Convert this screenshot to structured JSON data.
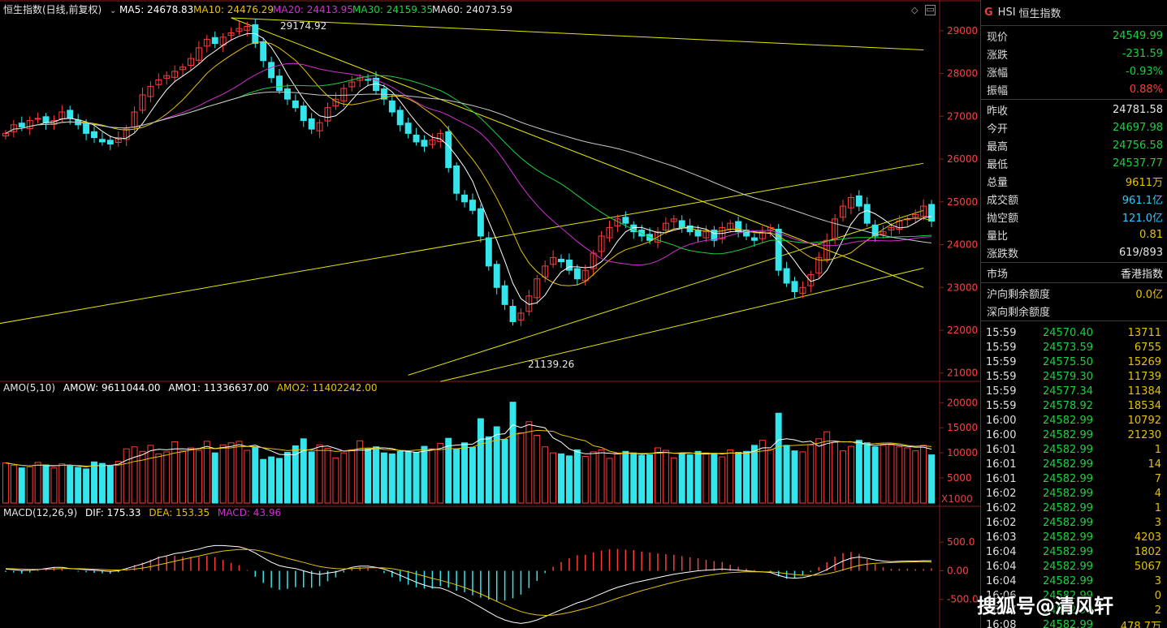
{
  "main_panel": {
    "title": "恒生指数(日线,前复权)",
    "ma5": "MA5: 24678.83",
    "ma10": "MA10: 24476.29",
    "ma20": "MA20: 24413.95",
    "ma30": "MA30: 24159.35",
    "ma60": "MA60: 24073.59",
    "high_label": "29174.92",
    "low_label": "21139.26",
    "y_ticks": [
      "29000",
      "28000",
      "27000",
      "26000",
      "25000",
      "24000",
      "23000",
      "22000",
      "21000"
    ],
    "colors": {
      "ma5": "#ffffff",
      "ma10": "#e6c200",
      "ma20": "#d030d0",
      "ma30": "#19d23f",
      "ma60": "#c8c8c8",
      "up": "#ff3b3b",
      "down": "#34e6ec",
      "trendline": "#e6e600"
    }
  },
  "amo_panel": {
    "label": "AMO(5,10)",
    "amow": "AMOW: 9611044.00",
    "amo1": "AMO1: 11336637.00",
    "amo2": "AMO2: 11402242.00",
    "y_ticks": [
      "20000",
      "15000",
      "10000",
      "5000"
    ],
    "unit": "X1000"
  },
  "macd_panel": {
    "label": "MACD(12,26,9)",
    "dif": "DIF: 175.33",
    "dea": "DEA: 153.35",
    "macd": "MACD: 43.96",
    "y_ticks": [
      "500.0",
      "0.00",
      "-500.0"
    ]
  },
  "sidebar": {
    "logo": "G",
    "code": "HSI",
    "name": "恒生指数",
    "quote": [
      {
        "k": "现价",
        "v": "24549.99",
        "c": "g1"
      },
      {
        "k": "涨跌",
        "v": "-231.59",
        "c": "g1"
      },
      {
        "k": "涨幅",
        "v": "-0.93%",
        "c": "g1"
      },
      {
        "k": "振幅",
        "v": "0.88%",
        "c": "r1"
      }
    ],
    "stats": [
      {
        "k": "昨收",
        "v": "24781.58",
        "c": "w1"
      },
      {
        "k": "今开",
        "v": "24697.98",
        "c": "g1"
      },
      {
        "k": "最高",
        "v": "24756.58",
        "c": "g1"
      },
      {
        "k": "最低",
        "v": "24537.77",
        "c": "g1"
      },
      {
        "k": "总量",
        "v": "9611万",
        "c": "y1"
      },
      {
        "k": "成交额",
        "v": "961.1亿",
        "c": "b1"
      },
      {
        "k": "抛空额",
        "v": "121.0亿",
        "c": "b1"
      },
      {
        "k": "量比",
        "v": "0.81",
        "c": "y1"
      },
      {
        "k": "涨跌数",
        "v": "619/893",
        "c": "w1"
      }
    ],
    "market": [
      {
        "k": "市场",
        "v": "香港指数",
        "c": "w1"
      }
    ],
    "quota": [
      {
        "k": "沪向剩余额度",
        "v": "0.0亿",
        "c": "y1"
      },
      {
        "k": "深向剩余额度",
        "v": "",
        "c": "y1"
      }
    ],
    "ticks": [
      {
        "t": "15:59",
        "p": "24570.40",
        "v": "13711"
      },
      {
        "t": "15:59",
        "p": "24573.59",
        "v": "6755"
      },
      {
        "t": "15:59",
        "p": "24575.50",
        "v": "15269"
      },
      {
        "t": "15:59",
        "p": "24579.30",
        "v": "11739"
      },
      {
        "t": "15:59",
        "p": "24577.34",
        "v": "11384"
      },
      {
        "t": "15:59",
        "p": "24578.92",
        "v": "18534"
      },
      {
        "t": "16:00",
        "p": "24582.99",
        "v": "10792"
      },
      {
        "t": "16:00",
        "p": "24582.99",
        "v": "21230"
      },
      {
        "t": "16:01",
        "p": "24582.99",
        "v": "1"
      },
      {
        "t": "16:01",
        "p": "24582.99",
        "v": "14"
      },
      {
        "t": "16:01",
        "p": "24582.99",
        "v": "7"
      },
      {
        "t": "16:02",
        "p": "24582.99",
        "v": "4"
      },
      {
        "t": "16:02",
        "p": "24582.99",
        "v": "1"
      },
      {
        "t": "16:02",
        "p": "24582.99",
        "v": "3"
      },
      {
        "t": "16:03",
        "p": "24582.99",
        "v": "4203"
      },
      {
        "t": "16:04",
        "p": "24582.99",
        "v": "1802"
      },
      {
        "t": "16:04",
        "p": "24582.99",
        "v": "5067"
      },
      {
        "t": "16:04",
        "p": "24582.99",
        "v": "3"
      },
      {
        "t": "16:06",
        "p": "24582.99",
        "v": "0"
      },
      {
        "t": "16:07",
        "p": "24582.99",
        "v": "2"
      },
      {
        "t": "16:08",
        "p": "24582.99",
        "v": "478.7万"
      }
    ]
  },
  "watermark": "搜狐号@清风轩",
  "chart_data": {
    "type": "candlestick",
    "title": "恒生指数(日线,前复权)",
    "ylim_price": [
      20900,
      29300
    ],
    "ylim_amo": [
      0,
      21500
    ],
    "ylim_macd": [
      -1000,
      900
    ],
    "close": [
      26600,
      26800,
      26750,
      26900,
      26950,
      26850,
      26900,
      27100,
      26950,
      26800,
      26600,
      26500,
      26400,
      26350,
      26500,
      26700,
      27100,
      27500,
      27700,
      27850,
      27950,
      28050,
      28150,
      28350,
      28600,
      28800,
      28700,
      28850,
      28950,
      29050,
      29100,
      28700,
      28300,
      27900,
      27600,
      27400,
      27200,
      26900,
      26700,
      26850,
      27200,
      27400,
      27650,
      27800,
      27900,
      27850,
      27600,
      27400,
      27100,
      26800,
      26600,
      26400,
      26300,
      26450,
      26600,
      25800,
      25200,
      25000,
      24800,
      24200,
      23500,
      23000,
      22600,
      22200,
      22400,
      22800,
      23200,
      23500,
      23700,
      23600,
      23400,
      23200,
      23400,
      23800,
      24200,
      24400,
      24600,
      24500,
      24300,
      24200,
      24100,
      24300,
      24500,
      24600,
      24400,
      24300,
      24200,
      24300,
      24100,
      24400,
      24500,
      24300,
      24200,
      24100,
      24300,
      24400,
      23400,
      23100,
      22900,
      23000,
      23300,
      23700,
      24100,
      24600,
      24900,
      25100,
      24900,
      24500,
      24200,
      24300,
      24400,
      24550,
      24600,
      24700,
      24900,
      24550
    ],
    "volume_k": [
      8000,
      7500,
      7000,
      7200,
      8100,
      7600,
      7000,
      7800,
      7400,
      7100,
      6800,
      8200,
      7900,
      7500,
      8300,
      10800,
      11200,
      10300,
      11500,
      9800,
      10200,
      12200,
      10400,
      11000,
      10500,
      12300,
      10000,
      11600,
      12000,
      12300,
      10500,
      11200,
      8700,
      9200,
      8900,
      10100,
      11400,
      12800,
      10200,
      11600,
      10900,
      9000,
      10000,
      10600,
      12400,
      10800,
      11200,
      10000,
      9800,
      10300,
      10200,
      10100,
      11300,
      10800,
      11900,
      12900,
      10800,
      12000,
      11100,
      16800,
      13200,
      15200,
      12700,
      20100,
      14000,
      16200,
      13500,
      11200,
      10000,
      9800,
      9400,
      10600,
      9300,
      10200,
      10600,
      8900,
      9900,
      10300,
      10000,
      9500,
      9600,
      11000,
      10500,
      9000,
      9900,
      9600,
      10300,
      10000,
      9800,
      9200,
      10600,
      10100,
      10300,
      11500,
      12500,
      10700,
      17900,
      11500,
      10400,
      10200,
      11600,
      12800,
      14200,
      12100,
      10400,
      11300,
      12500,
      12000,
      11200,
      11500,
      11600,
      11200,
      11000,
      10400,
      11500,
      9600
    ],
    "dif": [
      30,
      20,
      5,
      10,
      20,
      40,
      60,
      60,
      40,
      30,
      20,
      10,
      0,
      -10,
      0,
      40,
      80,
      120,
      170,
      230,
      260,
      300,
      320,
      350,
      380,
      420,
      440,
      440,
      430,
      420,
      380,
      310,
      230,
      150,
      90,
      60,
      40,
      0,
      -40,
      -60,
      -40,
      -20,
      20,
      60,
      80,
      80,
      60,
      30,
      -20,
      -80,
      -140,
      -200,
      -250,
      -290,
      -300,
      -350,
      -420,
      -480,
      -560,
      -640,
      -720,
      -800,
      -860,
      -900,
      -920,
      -900,
      -860,
      -800,
      -740,
      -680,
      -620,
      -560,
      -520,
      -460,
      -400,
      -340,
      -290,
      -250,
      -210,
      -180,
      -150,
      -120,
      -90,
      -60,
      -40,
      -20,
      0,
      10,
      20,
      30,
      20,
      10,
      0,
      -10,
      -20,
      -30,
      -80,
      -120,
      -130,
      -120,
      -90,
      -40,
      20,
      100,
      170,
      220,
      240,
      220,
      190,
      170,
      160,
      165,
      170,
      170,
      175,
      175
    ],
    "dea": [
      40,
      35,
      30,
      25,
      25,
      28,
      33,
      38,
      38,
      37,
      33,
      28,
      22,
      15,
      12,
      18,
      30,
      48,
      72,
      104,
      135,
      168,
      198,
      228,
      258,
      290,
      320,
      345,
      360,
      372,
      374,
      362,
      336,
      298,
      256,
      218,
      183,
      146,
      109,
      75,
      52,
      38,
      34,
      39,
      47,
      54,
      55,
      50,
      36,
      13,
      -18,
      -55,
      -94,
      -133,
      -166,
      -203,
      -246,
      -293,
      -346,
      -405,
      -468,
      -535,
      -600,
      -660,
      -712,
      -749,
      -772,
      -780,
      -775,
      -756,
      -729,
      -695,
      -660,
      -620,
      -576,
      -529,
      -481,
      -435,
      -390,
      -348,
      -309,
      -271,
      -235,
      -200,
      -168,
      -138,
      -110,
      -86,
      -65,
      -46,
      -33,
      -24,
      -19,
      -17,
      -18,
      -20,
      -32,
      -50,
      -66,
      -77,
      -80,
      -72,
      -54,
      -23,
      15,
      56,
      93,
      118,
      132,
      139,
      143,
      148,
      152,
      156,
      160,
      153
    ]
  }
}
